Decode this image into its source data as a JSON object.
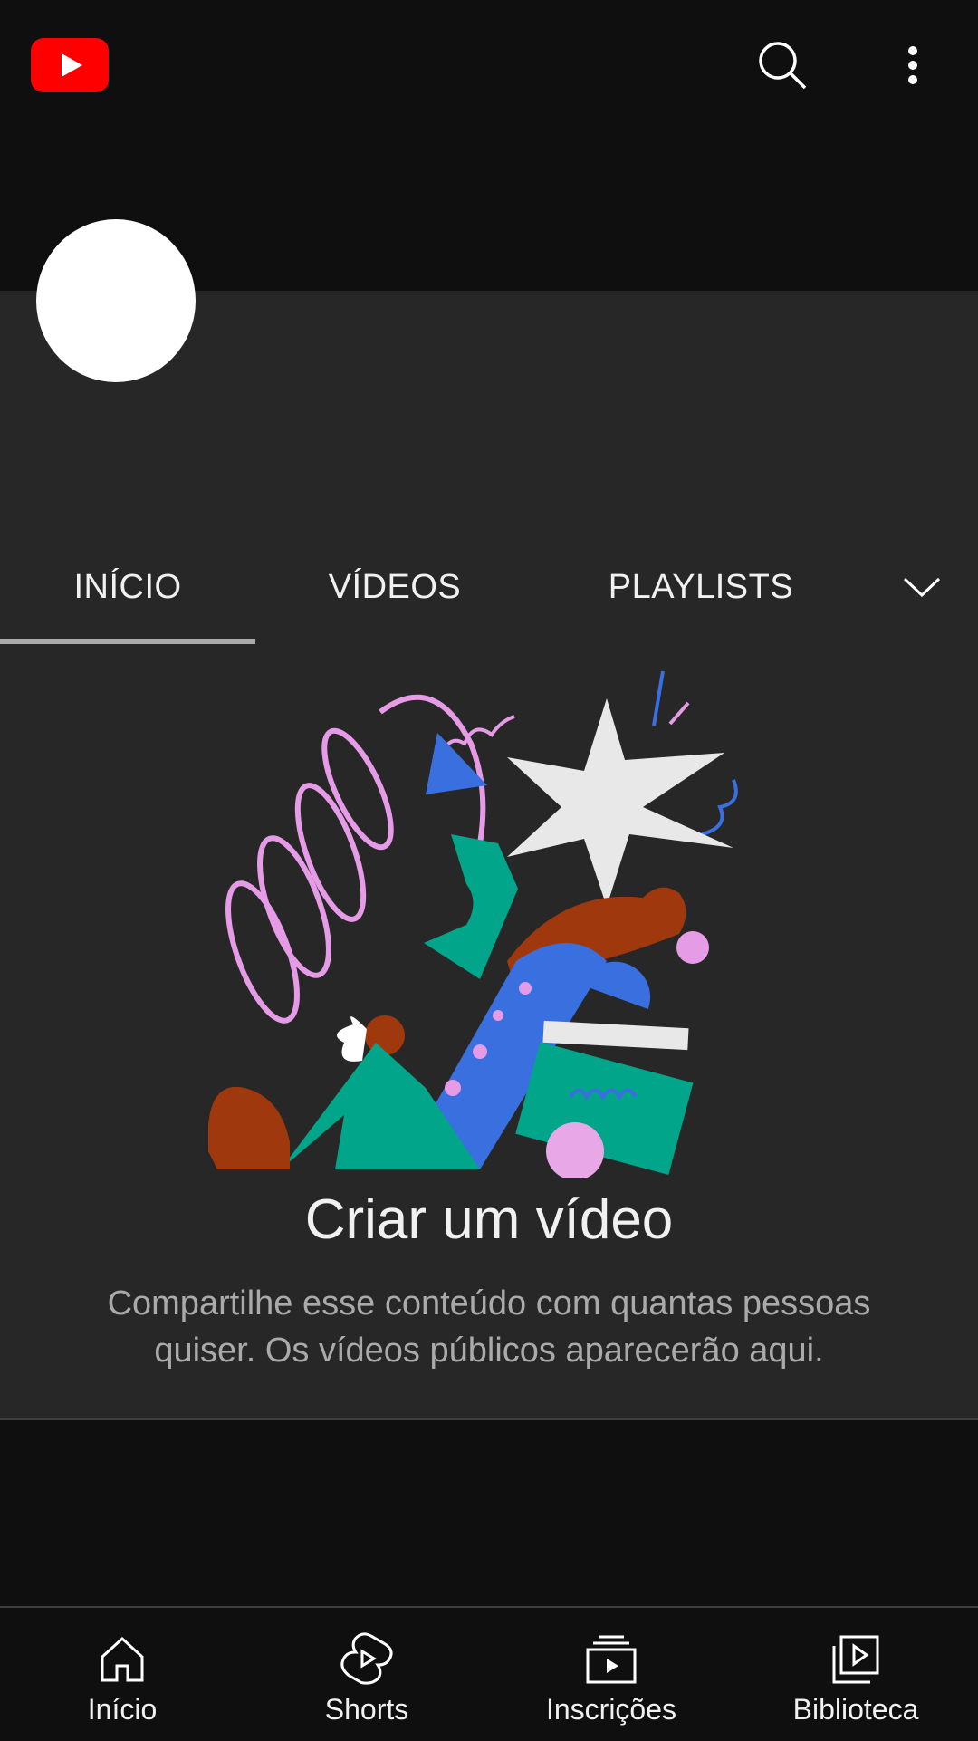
{
  "tabs": [
    {
      "label": "INÍCIO",
      "active": true
    },
    {
      "label": "VÍDEOS",
      "active": false
    },
    {
      "label": "PLAYLISTS",
      "active": false
    }
  ],
  "empty_state": {
    "title": "Criar um vídeo",
    "description": "Compartilhe esse conteúdo com quantas pessoas quiser. Os vídeos públicos aparecerão aqui."
  },
  "bottom_nav": [
    {
      "label": "Início",
      "icon": "home-icon"
    },
    {
      "label": "Shorts",
      "icon": "shorts-icon"
    },
    {
      "label": "Inscrições",
      "icon": "subscriptions-icon"
    },
    {
      "label": "Biblioteca",
      "icon": "library-icon"
    }
  ],
  "icons": {
    "logo": "youtube-logo",
    "search": "search-icon",
    "more": "more-vert-icon",
    "tab_more": "chevron-down-icon"
  },
  "colors": {
    "background": "#0f0f0f",
    "surface": "#272727",
    "brand_red": "#ff0000",
    "text_primary": "#f1f1f1",
    "text_secondary": "#aaaaaa"
  }
}
